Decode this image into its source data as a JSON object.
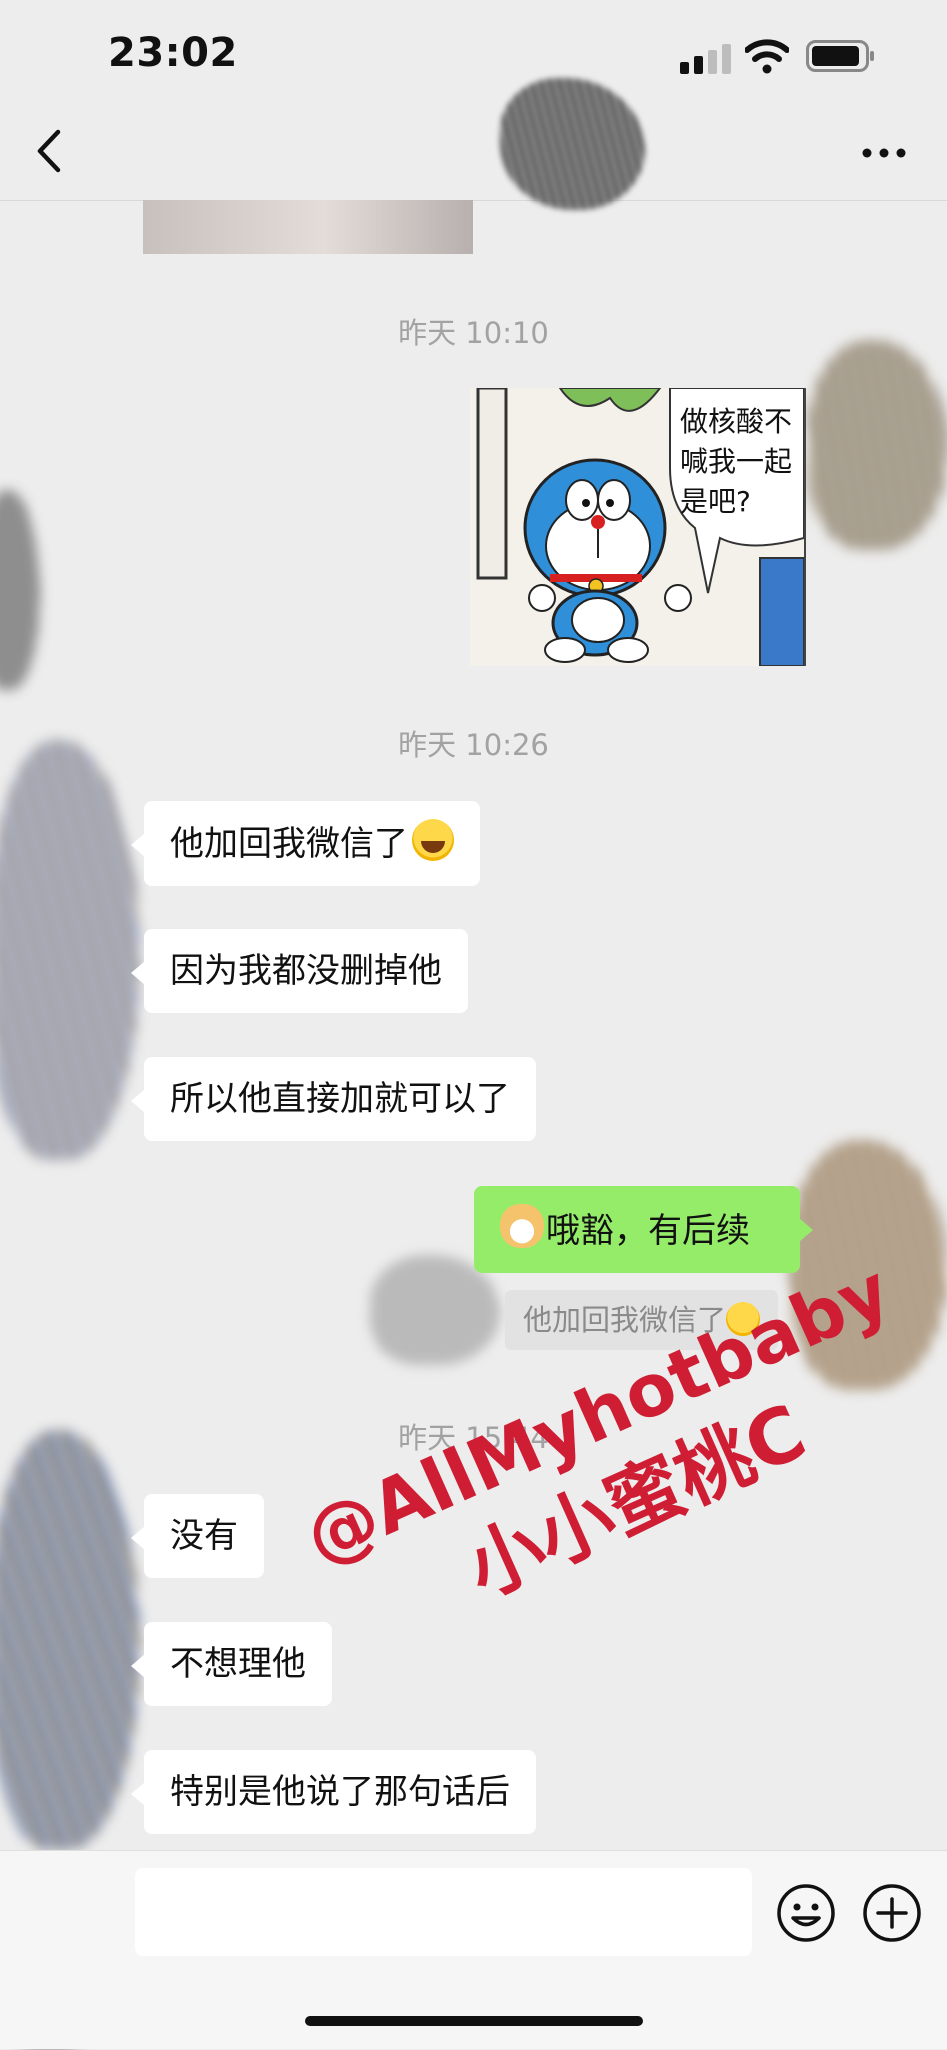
{
  "status_bar": {
    "time": "23:02"
  },
  "nav": {
    "title": ""
  },
  "messages": {
    "ts1": "昨天 10:10",
    "sticker_text": "做核酸不喊我一起是吧?",
    "ts2": "昨天 10:26",
    "in1": "他加回我微信了",
    "in2": "因为我都没删掉他",
    "in3": "所以他直接加就可以了",
    "out1": "哦豁，有后续",
    "quote": "他加回我微信了",
    "ts3": "昨天 15:44",
    "in4": "没有",
    "in5": "不想理他",
    "in6": "特别是他说了那句话后"
  },
  "watermark": {
    "line1": "@AllMyhotbaby",
    "line2": "小小蜜桃C",
    "color": "#cf1d33"
  },
  "colors": {
    "background": "#ededed",
    "bubble_out": "#95ec69",
    "bubble_in": "#ffffff"
  },
  "icons": [
    "back-icon",
    "more-icon",
    "signal-icon",
    "wifi-icon",
    "battery-icon",
    "emoji-face-icon",
    "plus-icon"
  ]
}
